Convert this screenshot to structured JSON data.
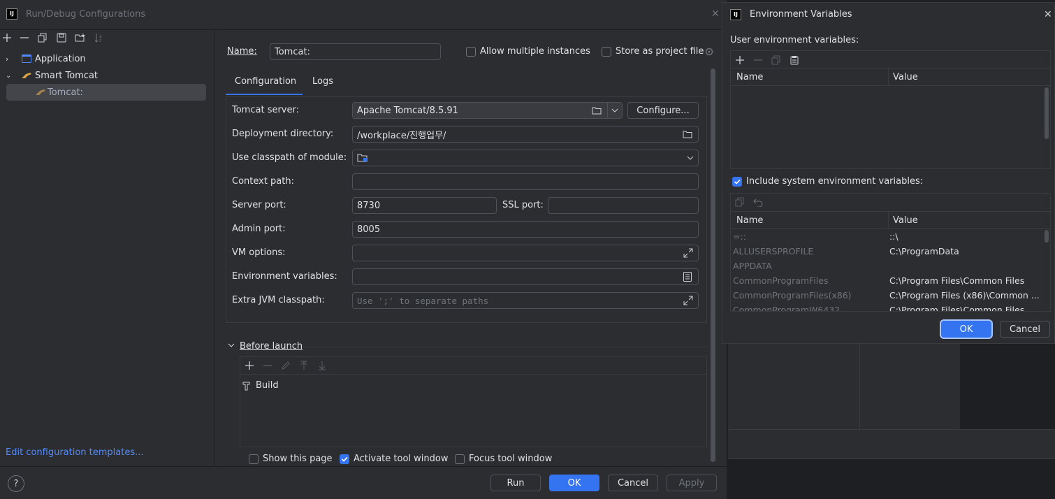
{
  "run_dialog": {
    "title": "Run/Debug Configurations",
    "tree": {
      "application": "Application",
      "smart_tomcat": "Smart Tomcat",
      "tomcat_item": "Tomcat:"
    },
    "edit_templates_link": "Edit configuration templates...",
    "name_label": "Name:",
    "name_value": "Tomcat:",
    "allow_multiple": "Allow multiple instances",
    "store_as_project": "Store as project file",
    "tabs": [
      "Configuration",
      "Logs"
    ],
    "form": {
      "tomcat_server_label": "Tomcat server:",
      "tomcat_server_value": "Apache Tomcat/8.5.91",
      "configure_button": "Configure...",
      "deployment_dir_label": "Deployment directory:",
      "deployment_dir_value": "/workplace/진행업무/",
      "classpath_module_label": "Use classpath of module:",
      "context_path_label": "Context path:",
      "server_port_label": "Server port:",
      "server_port_value": "8730",
      "ssl_port_label": "SSL port:",
      "admin_port_label": "Admin port:",
      "admin_port_value": "8005",
      "vm_options_label": "VM options:",
      "env_vars_label": "Environment variables:",
      "extra_jvm_label": "Extra JVM classpath:",
      "extra_jvm_placeholder": "Use ';' to separate paths"
    },
    "before_launch": {
      "title": "Before launch",
      "item": "Build"
    },
    "show_this_page": "Show this page",
    "activate_tool_window": "Activate tool window",
    "focus_tool_window": "Focus tool window",
    "buttons": {
      "run": "Run",
      "ok": "OK",
      "cancel": "Cancel",
      "apply": "Apply"
    },
    "help": "?"
  },
  "env_dialog": {
    "title": "Environment Variables",
    "user_vars_label": "User environment variables:",
    "col_name": "Name",
    "col_value": "Value",
    "include_system": "Include system environment variables:",
    "system_vars": [
      {
        "name": "=::",
        "value": "::\\"
      },
      {
        "name": "ALLUSERSPROFILE",
        "value": "C:\\ProgramData"
      },
      {
        "name": "APPDATA",
        "value": ""
      },
      {
        "name": "CommonProgramFiles",
        "value": "C:\\Program Files\\Common Files"
      },
      {
        "name": "CommonProgramFiles(x86)",
        "value": "C:\\Program Files (x86)\\Common ..."
      },
      {
        "name": "CommonProgramW6432",
        "value": "C:\\Program Files\\Common Files"
      }
    ],
    "ok": "OK",
    "cancel": "Cancel"
  },
  "colors": {
    "accent": "#3574f0",
    "link": "#548af7",
    "background": "#2b2d30"
  }
}
